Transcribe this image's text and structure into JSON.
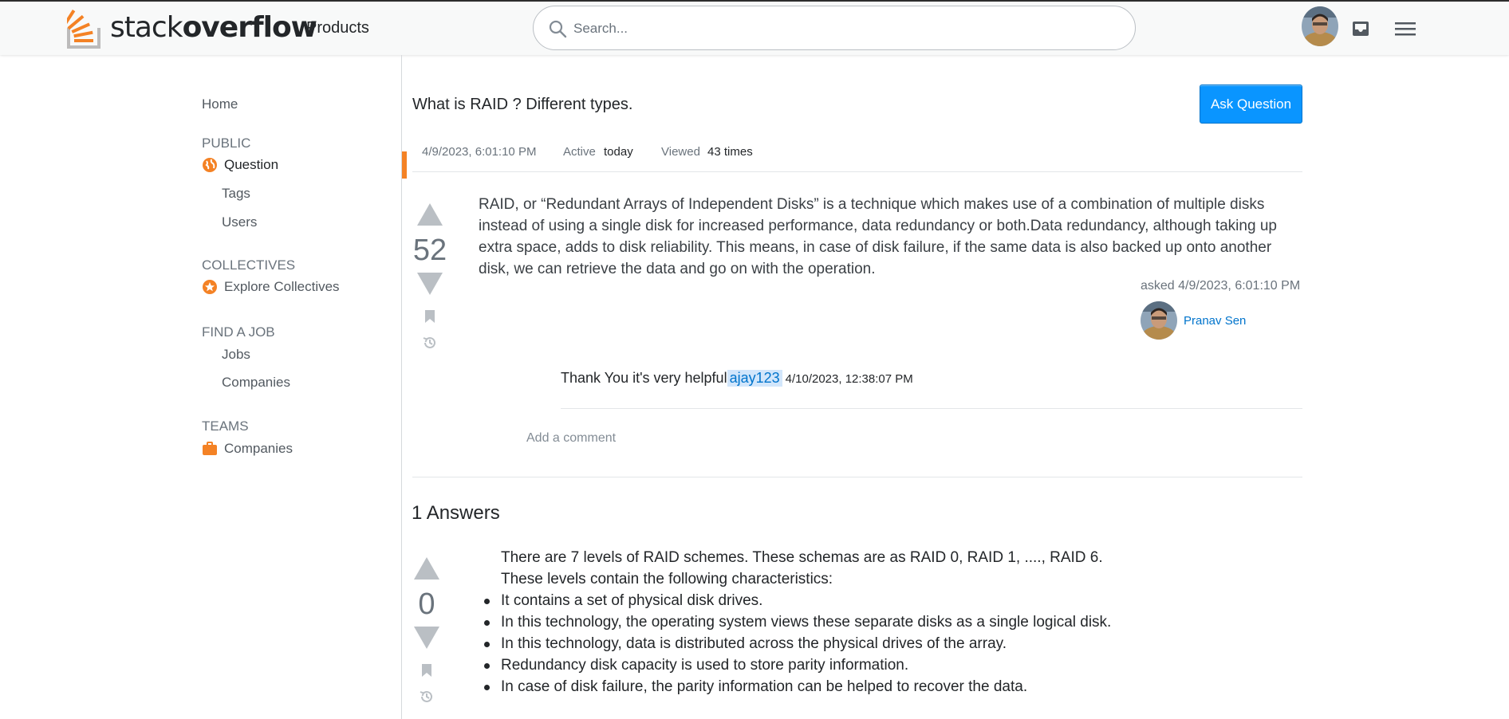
{
  "header": {
    "logo_light": "stack",
    "logo_bold": "overflow",
    "products_label": "Products",
    "search_placeholder": "Search..."
  },
  "sidebar": {
    "home": "Home",
    "public_heading": "PUBLIC",
    "question": "Question",
    "tags": "Tags",
    "users": "Users",
    "collectives_heading": "COLLECTIVES",
    "explore_collectives": "Explore Collectives",
    "find_job_heading": "FIND A JOB",
    "jobs": "Jobs",
    "companies_job": "Companies",
    "teams_heading": "TEAMS",
    "companies_team": "Companies"
  },
  "question": {
    "title": "What is RAID ? Different types.",
    "ask_button": "Ask Question",
    "posted": "4/9/2023, 6:01:10 PM",
    "active_label": "Active",
    "active_value": "today",
    "viewed_label": "Viewed",
    "viewed_value": "43 times",
    "votes": "52",
    "body": "RAID, or “Redundant Arrays of Independent Disks” is a technique which makes use of a combination of multiple disks instead of using a single disk for increased performance, data redundancy or both.Data redundancy, although taking up extra space, adds to disk reliability. This means, in case of disk failure, if the same data is also backed up onto another disk, we can retrieve the data and go on with the operation.",
    "asked": "asked 4/9/2023, 6:01:10 PM",
    "author": "Pranav Sen",
    "comment_text": "Thank You it's very helpful",
    "comment_user": "ajay123",
    "comment_date": "4/10/2023, 12:38:07 PM",
    "add_comment": "Add a comment"
  },
  "answers": {
    "count_label": "1 Answers",
    "items": [
      {
        "votes": "0",
        "intro1": "There are 7 levels of RAID schemes. These schemas are as RAID 0, RAID 1, ...., RAID 6.",
        "intro2": "These levels contain the following characteristics:",
        "bullets": [
          "It contains a set of physical disk drives.",
          "In this technology, the operating system views these separate disks as a single logical disk.",
          "In this technology, data is distributed across the physical drives of the array.",
          "Redundancy disk capacity is used to store parity information.",
          "In case of disk failure, the parity information can be helped to recover the data."
        ]
      }
    ]
  },
  "colors": {
    "brand_orange": "#f48225",
    "link_blue": "#0074cc",
    "button_blue": "#0a95ff"
  },
  "icons": [
    "stackoverflow-logo-icon",
    "search-icon",
    "inbox-icon",
    "hamburger-menu-icon",
    "globe-icon",
    "star-badge-icon",
    "briefcase-icon",
    "upvote-icon",
    "downvote-icon",
    "bookmark-icon",
    "history-icon"
  ]
}
